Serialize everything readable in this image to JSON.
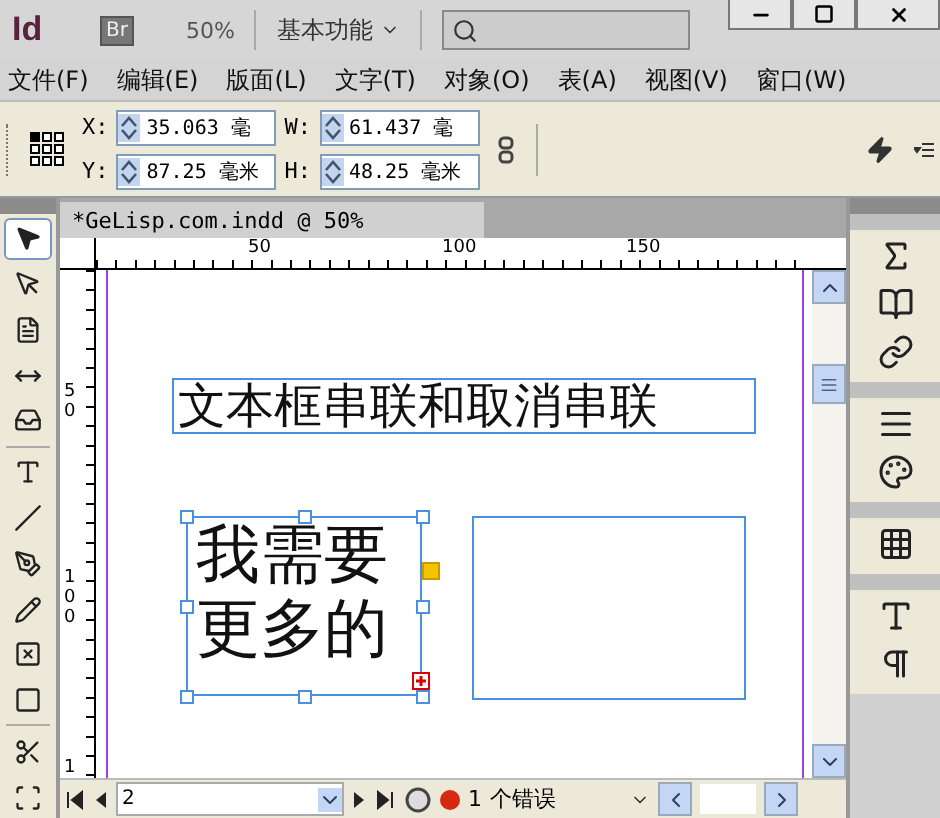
{
  "app_bar": {
    "logo": "Id",
    "bridge": "Br",
    "zoom": "50%",
    "workspace": "基本功能"
  },
  "menu": [
    {
      "label": "文件(F)"
    },
    {
      "label": "编辑(E)"
    },
    {
      "label": "版面(L)"
    },
    {
      "label": "文字(T)"
    },
    {
      "label": "对象(O)"
    },
    {
      "label": "表(A)"
    },
    {
      "label": "视图(V)"
    },
    {
      "label": "窗口(W)"
    }
  ],
  "control_panel": {
    "fields": [
      {
        "label": "X:",
        "value": "35.063 毫"
      },
      {
        "label": "W:",
        "value": "61.437 毫"
      },
      {
        "label": "Y:",
        "value": "87.25 毫米"
      },
      {
        "label": "H:",
        "value": "48.25 毫米"
      }
    ]
  },
  "tools": [
    {
      "kind": "selection",
      "selected": true
    },
    {
      "kind": "direct",
      "selected": false
    },
    {
      "kind": "page",
      "selected": false
    },
    {
      "kind": "gap",
      "selected": false
    },
    {
      "kind": "collector",
      "selected": false
    },
    {
      "kind": "type",
      "selected": false
    },
    {
      "kind": "line",
      "selected": false
    },
    {
      "kind": "pen",
      "selected": false
    },
    {
      "kind": "pencil",
      "selected": false
    },
    {
      "kind": "frame",
      "selected": false
    },
    {
      "kind": "rect",
      "selected": false
    },
    {
      "kind": "scissors",
      "selected": false
    },
    {
      "kind": "transform",
      "selected": false
    }
  ],
  "document": {
    "tab": "*GeLisp.com.indd @ 50%",
    "ruler_h": [
      "50",
      "100",
      "150"
    ],
    "ruler_v": [
      "50",
      "100",
      "1"
    ],
    "frames": [
      {
        "kind": "text",
        "lines": [
          "文本框串联和取消串联"
        ],
        "selected": false
      },
      {
        "kind": "text",
        "lines": [
          "我需要",
          "更多的"
        ],
        "selected": true,
        "overset": true
      },
      {
        "kind": "empty",
        "selected": false
      }
    ]
  },
  "status_bar": {
    "page": "2",
    "error_count": "1",
    "error_label": "个错误"
  },
  "panels": [
    {
      "kind": "effects"
    },
    {
      "kind": "pages"
    },
    {
      "kind": "links"
    },
    {
      "kind": "stroke"
    },
    {
      "kind": "swatches"
    },
    {
      "kind": "table"
    },
    {
      "kind": "charstyle"
    },
    {
      "kind": "parastyle"
    }
  ]
}
